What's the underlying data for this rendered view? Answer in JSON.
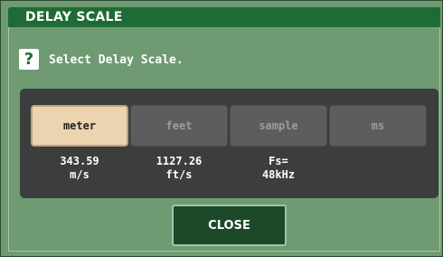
{
  "dialog": {
    "title": "DELAY SCALE",
    "help_icon": "question-icon",
    "help_glyph": "?",
    "prompt": "Select Delay Scale."
  },
  "scale_options": [
    {
      "label": "meter",
      "selected": true,
      "info_line1": "343.59",
      "info_line2": "m/s"
    },
    {
      "label": "feet",
      "selected": false,
      "info_line1": "1127.26",
      "info_line2": "ft/s"
    },
    {
      "label": "sample",
      "selected": false,
      "info_line1": "Fs=",
      "info_line2": "48kHz"
    },
    {
      "label": "ms",
      "selected": false,
      "info_line1": "",
      "info_line2": ""
    }
  ],
  "close_label": "CLOSE",
  "colors": {
    "background": "#6f9a72",
    "titlebar": "#1f6b35",
    "panel": "#3b3e3d",
    "selected": "#ecd4b0",
    "close_button": "#1c4a29"
  }
}
